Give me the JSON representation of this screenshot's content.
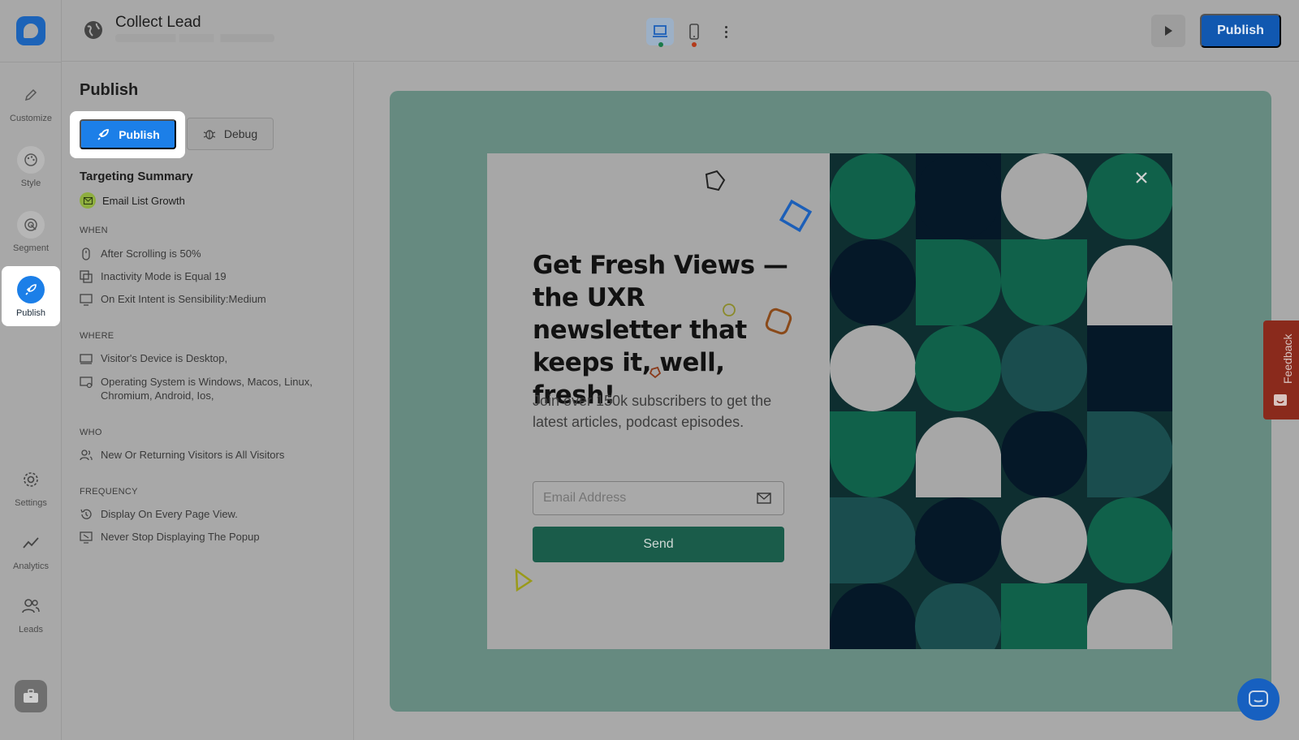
{
  "topbar": {
    "title": "Collect Lead",
    "publish_label": "Publish"
  },
  "rail": {
    "items": [
      {
        "label": "Customize"
      },
      {
        "label": "Style"
      },
      {
        "label": "Segment"
      },
      {
        "label": "Publish"
      },
      {
        "label": "Settings"
      },
      {
        "label": "Analytics"
      },
      {
        "label": "Leads"
      }
    ]
  },
  "panel": {
    "title": "Publish",
    "publish_button": "Publish",
    "debug_button": "Debug",
    "summary_title": "Targeting Summary",
    "goal": "Email List Growth",
    "sections": {
      "when": {
        "label": "WHEN",
        "rows": [
          "After Scrolling is 50%",
          "Inactivity Mode is Equal 19",
          "On Exit Intent is Sensibility:Medium"
        ]
      },
      "where": {
        "label": "WHERE",
        "rows": [
          "Visitor's Device is Desktop,",
          "Operating System is Windows, Macos, Linux, Chromium, Android, Ios,"
        ]
      },
      "who": {
        "label": "WHO",
        "rows": [
          "New Or Returning Visitors is All Visitors"
        ]
      },
      "frequency": {
        "label": "FREQUENCY",
        "rows": [
          "Display On Every Page View.",
          "Never Stop Displaying The Popup"
        ]
      }
    }
  },
  "popup": {
    "headline": "Get Fresh Views — the UXR newsletter that keeps it, well, fresh!",
    "subtext": "Join over 150k subscribers to get the latest articles, podcast episodes.",
    "email_placeholder": "Email Address",
    "send_label": "Send"
  },
  "feedback": {
    "label": "Feedback"
  },
  "colors": {
    "brand": "#1c7fe8",
    "publish_top": "#1158b0",
    "popup_button": "#1a5c4a",
    "canvas": "#668a80",
    "feedback": "#8a2a1c"
  }
}
